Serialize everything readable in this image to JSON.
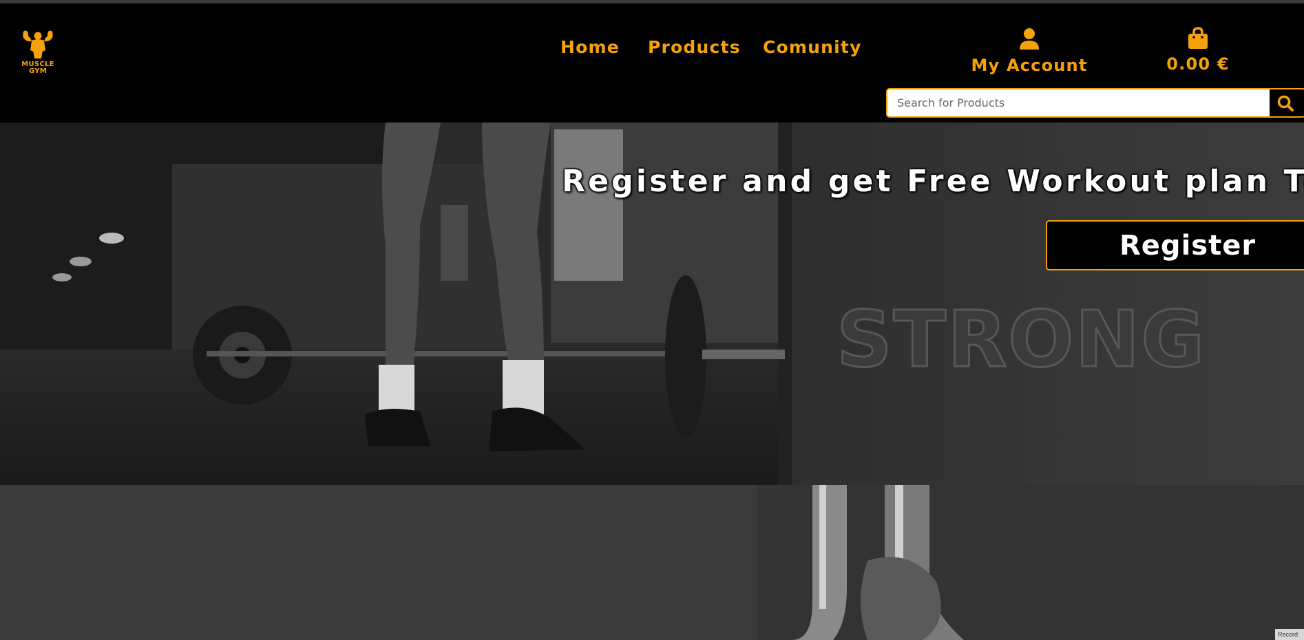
{
  "brand": {
    "logo_line1": "MUSCLE",
    "logo_line2": "GYM",
    "accent_color": "#f5a20a"
  },
  "nav": {
    "items": [
      {
        "label": "Home"
      },
      {
        "label": "Products"
      },
      {
        "label": "Comunity"
      }
    ]
  },
  "account": {
    "label": "My Account",
    "icon": "user-icon"
  },
  "cart": {
    "total": "0.00 €",
    "icon": "shopping-bag-icon"
  },
  "search": {
    "placeholder": "Search for Products",
    "value": "",
    "icon": "search-icon"
  },
  "hero": {
    "headline": "Register and get Free Workout plan Today!",
    "button_label": "Register",
    "engraved_text": "STRONG"
  },
  "corner_badge": {
    "label": "Record"
  }
}
